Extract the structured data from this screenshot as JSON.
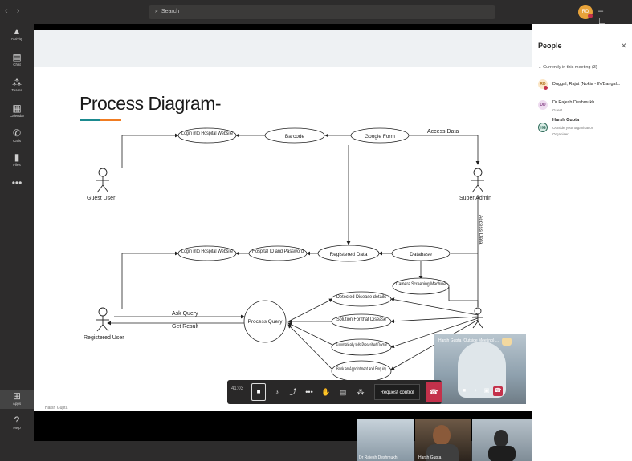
{
  "topbar": {
    "nav_arrows": "‹ ›",
    "search_placeholder": "Search",
    "avatar_initials": "RD",
    "win_ctrls": "– ☐ ✕"
  },
  "rail": [
    {
      "icon": "bell-icon",
      "glyph": "🔔",
      "label": "Activity"
    },
    {
      "icon": "chat-icon",
      "glyph": "▤",
      "label": "Chat"
    },
    {
      "icon": "teams-icon",
      "glyph": "⁂",
      "label": "Teams"
    },
    {
      "icon": "calendar-icon",
      "glyph": "▦",
      "label": "Calendar"
    },
    {
      "icon": "calls-icon",
      "glyph": "✆",
      "label": "Calls"
    },
    {
      "icon": "files-icon",
      "glyph": "▮",
      "label": "Files"
    },
    {
      "icon": "more-icon",
      "glyph": "•••",
      "label": ""
    }
  ],
  "rail_bottom": [
    {
      "icon": "apps-icon",
      "glyph": "⊞",
      "label": "Apps"
    },
    {
      "icon": "help-icon",
      "glyph": "?",
      "label": "Help"
    }
  ],
  "slide": {
    "title": "Process Diagram-",
    "presenter_footer": "Harsh Gupta",
    "colors": {
      "underline_teal": "#1b8a8f",
      "underline_orange": "#f07c22"
    }
  },
  "diagram": {
    "actors": [
      "Guest User",
      "Super Admin",
      "Registered User"
    ],
    "ovals": [
      "Login into Hospital Website",
      "Barcode",
      "Google Form",
      "Login into Hospital Website",
      "Hospital ID and Password",
      "Registered Data",
      "Database",
      "Camera Screening Machine",
      "Process Query",
      "Detected Disease details",
      "Solution For that Disease",
      "Automatically tells Prescribed Doctor",
      "Book an Appointment and Enquiry"
    ],
    "edge_labels": [
      "Access Data",
      "Access Data",
      "Ask Query",
      "Get Result"
    ]
  },
  "people": {
    "title": "People",
    "section": "Currently in this meeting (3)",
    "members": [
      {
        "initials": "RD",
        "name": "Duggal, Rajat (Nokia - IN/Bangal...",
        "sub": "",
        "color": "#e8a33a",
        "bg": "#fbe6c7"
      },
      {
        "initials": "DD",
        "name": "Dr Rajesh Deshmukh",
        "sub": "Guest",
        "color": "#8b4a8c",
        "bg": "#eedcf0"
      },
      {
        "initials": "HG",
        "name": "Harsh Gupta",
        "sub": "Outside your organisation",
        "sub2": "Organiser",
        "color": "#2f6b5a",
        "bg": "#d8ece5"
      }
    ]
  },
  "toolbar": {
    "time": "41:03",
    "request_control": "Request control"
  },
  "selfview": {
    "label": "Harsh Gupta (Outside Meeting) ..."
  },
  "thumbs": [
    {
      "label": "Dr Rajesh Deshmukh"
    },
    {
      "label": "Harsh Gupta"
    },
    {
      "label": ""
    }
  ]
}
